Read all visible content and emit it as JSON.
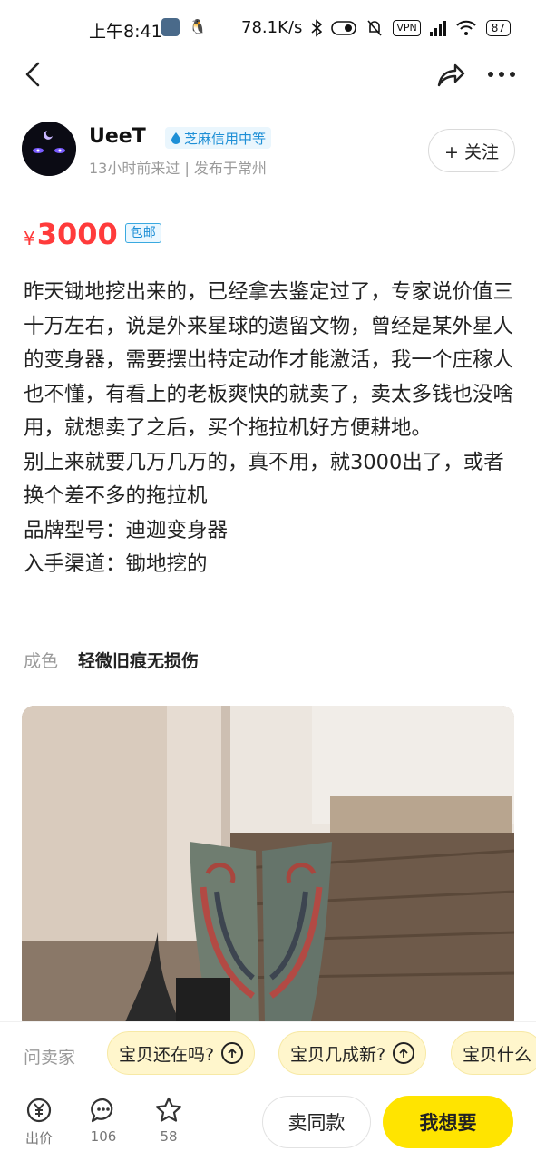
{
  "status_bar": {
    "time": "上午8:41",
    "net_speed": "78.1K/s",
    "vpn": "VPN",
    "battery": "87"
  },
  "nav": {
    "icons": [
      "back-icon",
      "share-icon",
      "more-icon"
    ]
  },
  "seller": {
    "name": "UeeT",
    "credit": "芝麻信用中等",
    "meta": "13小时前来过 | 发布于常州",
    "follow_label": "+ 关注"
  },
  "price": {
    "symbol": "¥",
    "value": "3000",
    "shipping": "包邮"
  },
  "description": {
    "lines": [
      "昨天锄地挖出来的，已经拿去鉴定过了，专家说价值三十万左右，说是外来星球的遗留文物，曾经是某外星人的变身器，需要摆出特定动作才能激活，我一个庄稼人也不懂，有看上的老板爽快的就卖了，卖太多钱也没啥用，就想卖了之后，买个拖拉机好方便耕地。",
      "别上来就要几万几万的，真不用，就3000出了，或者换个差不多的拖拉机",
      "品牌型号：迪迦变身器",
      "入手渠道：锄地挖的"
    ]
  },
  "condition": {
    "label": "成色",
    "value": "轻微旧痕无损伤"
  },
  "quick_questions": {
    "ask_label": "问卖家",
    "chips": [
      "宝贝还在吗?",
      "宝贝几成新?",
      "宝贝什么"
    ]
  },
  "toolbar": {
    "offer_label": "出价",
    "comment_count": "106",
    "fav_count": "58",
    "same_label": "卖同款",
    "want_label": "我想要"
  },
  "colors": {
    "price": "#ff3b3b",
    "want_button": "#ffe400",
    "credit": "#1e8fd6"
  }
}
